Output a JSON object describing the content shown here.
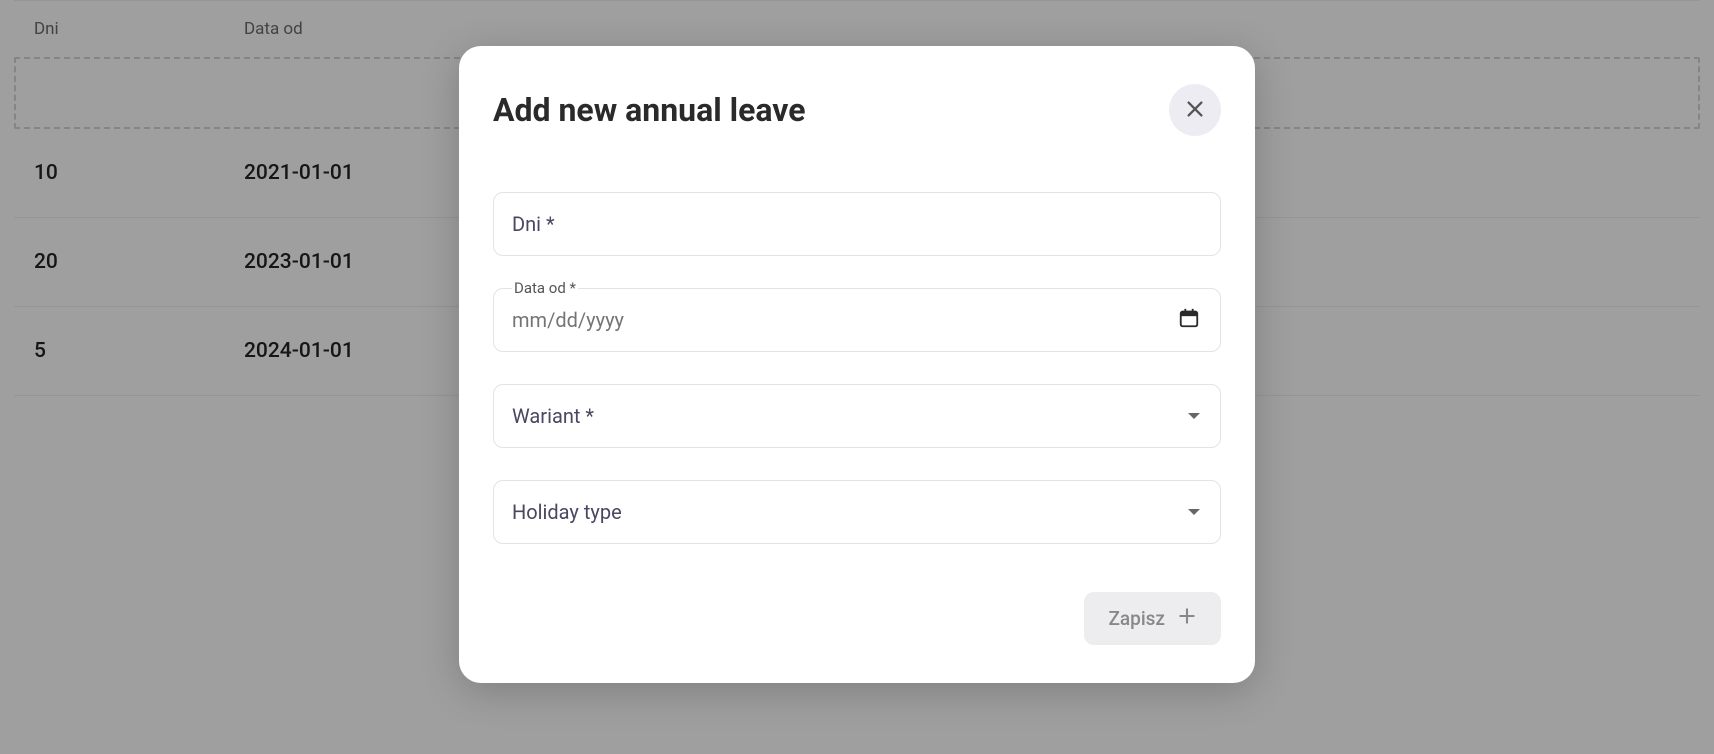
{
  "table": {
    "headers": {
      "days": "Dni",
      "date": "Data od"
    },
    "rows": [
      {
        "days": "10",
        "date": "2021-01-01"
      },
      {
        "days": "20",
        "date": "2023-01-01"
      },
      {
        "days": "5",
        "date": "2024-01-01"
      }
    ]
  },
  "modal": {
    "title": "Add new annual leave",
    "fields": {
      "days_label": "Dni *",
      "date_label": "Data od *",
      "date_placeholder": "mm/dd/yyyy",
      "variant_label": "Wariant *",
      "holiday_type_label": "Holiday type"
    },
    "save_label": "Zapisz"
  }
}
